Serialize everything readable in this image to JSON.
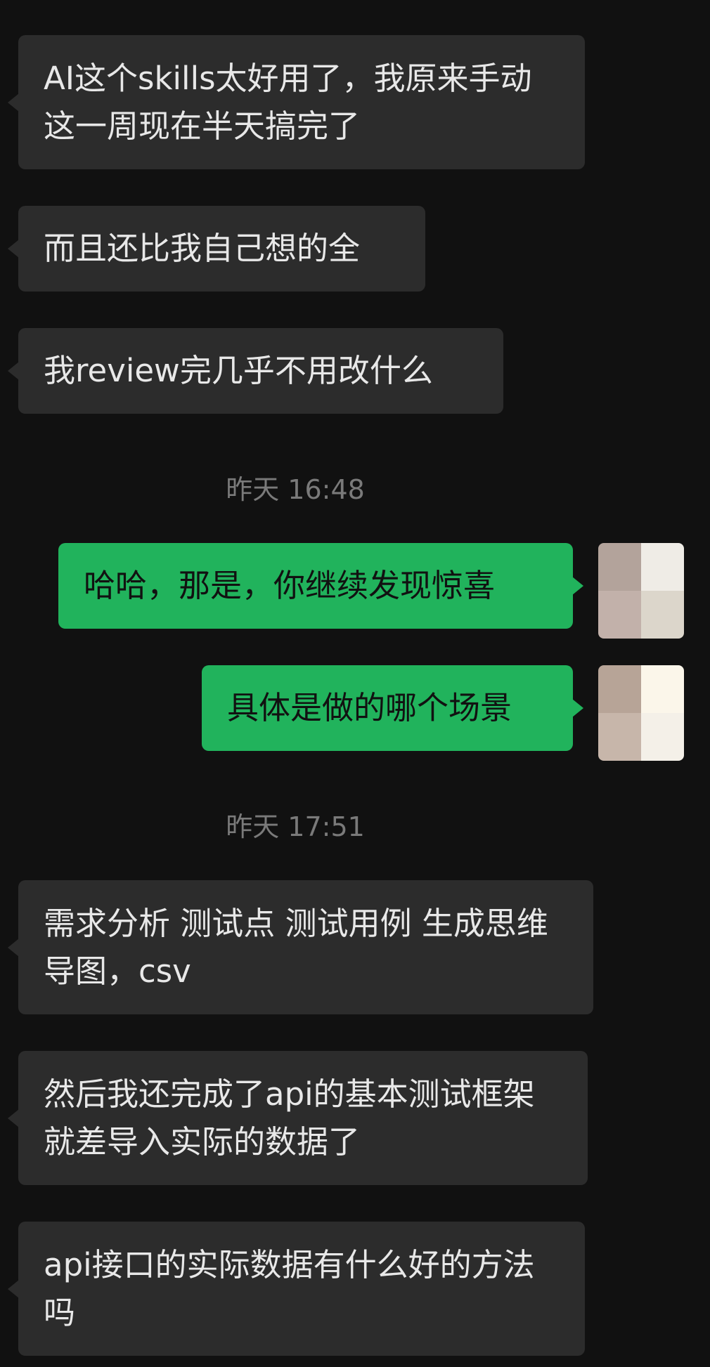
{
  "messages": [
    {
      "id": "m1",
      "direction": "in",
      "text": "AI这个skills太好用了，我原来手动这一周现在半天搞完了"
    },
    {
      "id": "m2",
      "direction": "in",
      "text": "而且还比我自己想的全"
    },
    {
      "id": "m3",
      "direction": "in",
      "text": "我review完几乎不用改什么"
    },
    {
      "id": "m4",
      "direction": "out",
      "text": "哈哈，那是，你继续发现惊喜"
    },
    {
      "id": "m5",
      "direction": "out",
      "text": "具体是做的哪个场景"
    },
    {
      "id": "m6",
      "direction": "in",
      "text": "需求分析 测试点 测试用例 生成思维导图，csv"
    },
    {
      "id": "m7",
      "direction": "in",
      "text": "然后我还完成了api的基本测试框架就差导入实际的数据了"
    },
    {
      "id": "m8",
      "direction": "in",
      "text": "api接口的实际数据有什么好的方法吗"
    }
  ],
  "timestamps": [
    {
      "id": "t1",
      "text": "昨天 16:48"
    },
    {
      "id": "t2",
      "text": "昨天 17:51"
    }
  ],
  "avatar_colors": {
    "a": [
      "#b3a39b",
      "#efece6",
      "#c2b1aa",
      "#dcd6cb"
    ],
    "b": [
      "#b7a497",
      "#fbf6ea",
      "#c7b6aa",
      "#f4f0e8"
    ]
  }
}
